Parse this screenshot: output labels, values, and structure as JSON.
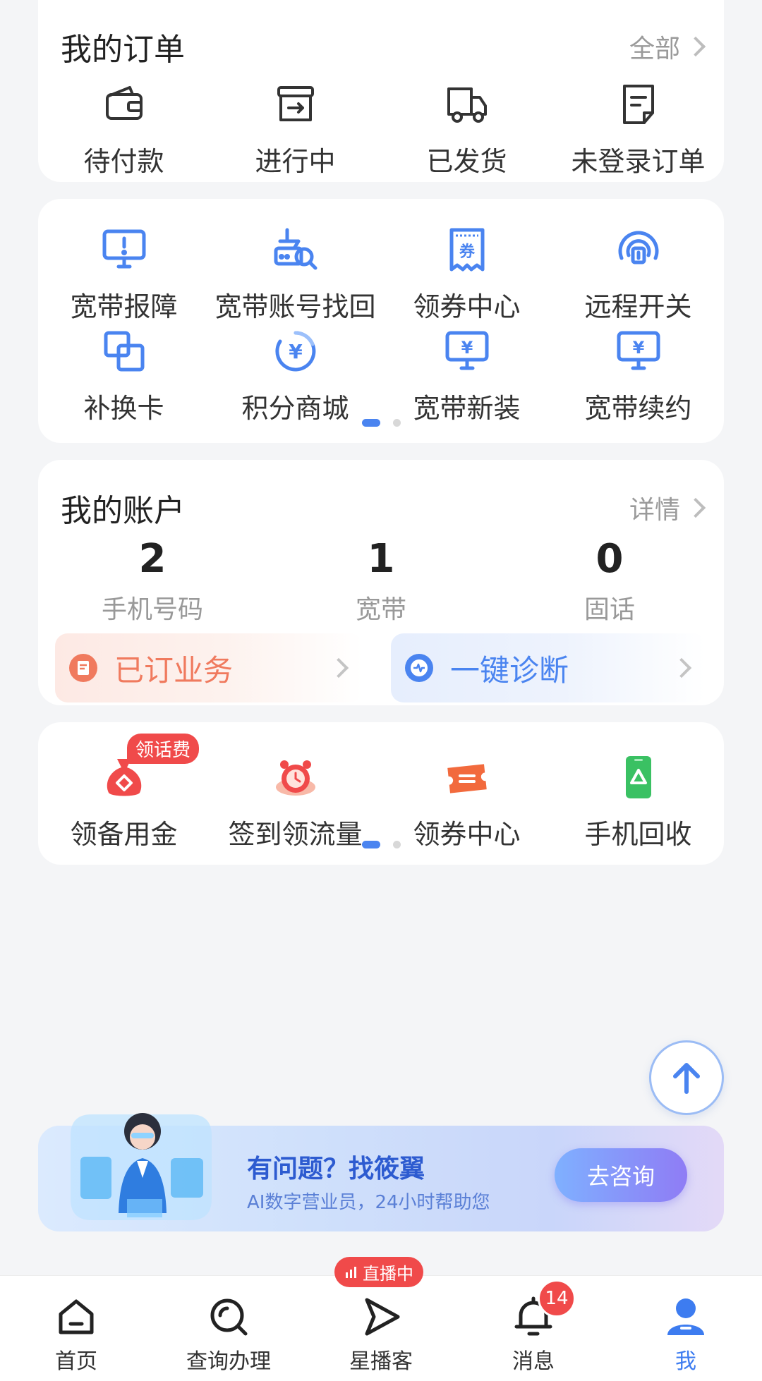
{
  "orders": {
    "title": "我的订单",
    "more": "全部",
    "items": [
      {
        "label": "待付款",
        "icon": "wallet-icon"
      },
      {
        "label": "进行中",
        "icon": "box-arrow-icon"
      },
      {
        "label": "已发货",
        "icon": "truck-icon"
      },
      {
        "label": "未登录订单",
        "icon": "document-icon"
      }
    ]
  },
  "services": {
    "row1": [
      {
        "label": "宽带报障",
        "icon": "monitor-alert-icon"
      },
      {
        "label": "宽带账号找回",
        "icon": "router-search-icon"
      },
      {
        "label": "领券中心",
        "icon": "coupon-icon"
      },
      {
        "label": "远程开关",
        "icon": "remote-switch-icon"
      }
    ],
    "row2": [
      {
        "label": "补换卡",
        "icon": "sim-swap-icon"
      },
      {
        "label": "积分商城",
        "icon": "points-yen-icon"
      },
      {
        "label": "宽带新装",
        "icon": "monitor-yen-icon"
      },
      {
        "label": "宽带续约",
        "icon": "monitor-yen-icon"
      }
    ],
    "coupon_glyph": "券",
    "yen_glyph": "¥"
  },
  "account": {
    "title": "我的账户",
    "more": "详情",
    "stats": [
      {
        "value": "2",
        "label": "手机号码"
      },
      {
        "value": "1",
        "label": "宽带"
      },
      {
        "value": "0",
        "label": "固话"
      }
    ],
    "subscribed": "已订业务",
    "diagnose": "一键诊断"
  },
  "promos": {
    "badge": "领话费",
    "items": [
      {
        "label": "领备用金",
        "icon": "money-bag-icon"
      },
      {
        "label": "签到领流量",
        "icon": "alarm-clock-icon"
      },
      {
        "label": "领券中心",
        "icon": "ticket-icon"
      },
      {
        "label": "手机回收",
        "icon": "phone-recycle-icon"
      }
    ]
  },
  "banner": {
    "title": "有问题？找筱翼",
    "subtitle": "AI数字营业员，24小时帮助您",
    "button": "去咨询"
  },
  "tabbar": {
    "live_tag": "直播中",
    "message_count": "14",
    "items": [
      {
        "label": "首页",
        "icon": "home-icon"
      },
      {
        "label": "查询办理",
        "icon": "search-icon"
      },
      {
        "label": "星播客",
        "icon": "play-icon"
      },
      {
        "label": "消息",
        "icon": "bell-icon"
      },
      {
        "label": "我",
        "icon": "person-icon"
      }
    ]
  },
  "colors": {
    "accent": "#4a84f0",
    "red": "#f04a4a",
    "active_tab": "#3d7cf0"
  }
}
